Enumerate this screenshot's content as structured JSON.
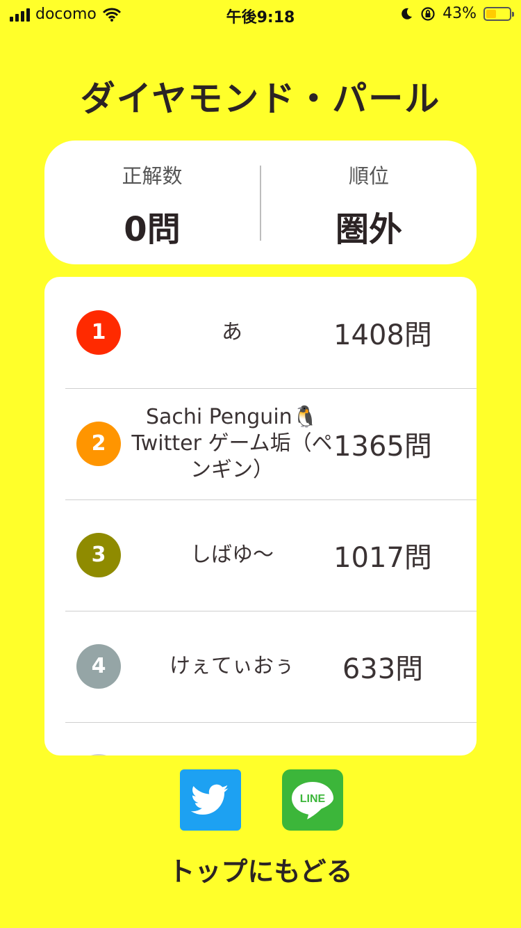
{
  "status_bar": {
    "carrier": "docomo",
    "time": "午後9:18",
    "battery": "43%",
    "battery_level": 0.43
  },
  "title": "ダイヤモンド・パール",
  "summary": {
    "correct_label": "正解数",
    "correct_value": "0問",
    "rank_label": "順位",
    "rank_value": "圏外"
  },
  "leaderboard": [
    {
      "rank": "1",
      "name": "あ",
      "score": "1408問",
      "color": "#ff2a00"
    },
    {
      "rank": "2",
      "name": "Sachi Penguin🐧 Twitter ゲーム垢（ペンギン）",
      "score": "1365問",
      "color": "#ff9500"
    },
    {
      "rank": "3",
      "name": "しばゆ〜",
      "score": "1017問",
      "color": "#8f8b00"
    },
    {
      "rank": "4",
      "name": "けぇてぃおぅ",
      "score": "633問",
      "color": "#95a5a6"
    }
  ],
  "share": {
    "twitter_icon": "twitter-bird-icon",
    "line_icon": "line-logo-icon",
    "line_text": "LINE"
  },
  "back_label": "トップにもどる"
}
